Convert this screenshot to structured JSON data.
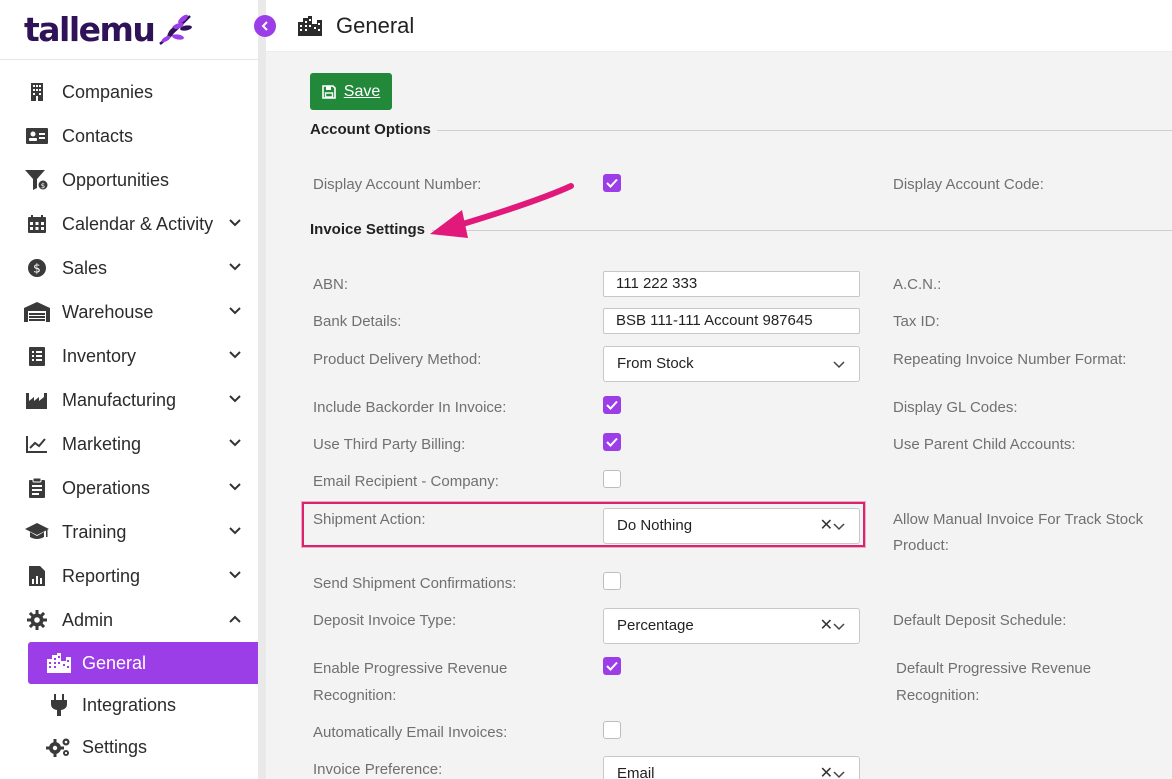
{
  "brand": {
    "logo_text": "tallemu",
    "accent": "#9b3ee8",
    "save_green": "#23893a",
    "annotation_pink": "#d9236f"
  },
  "sidebar": {
    "items": [
      {
        "label": "Companies",
        "icon": "building-icon",
        "expandable": false
      },
      {
        "label": "Contacts",
        "icon": "contact-card-icon",
        "expandable": false
      },
      {
        "label": "Opportunities",
        "icon": "funnel-dollar-icon",
        "expandable": false
      },
      {
        "label": "Calendar & Activity",
        "icon": "calendar-icon",
        "expandable": true
      },
      {
        "label": "Sales",
        "icon": "dollar-coin-icon",
        "expandable": true
      },
      {
        "label": "Warehouse",
        "icon": "warehouse-icon",
        "expandable": true
      },
      {
        "label": "Inventory",
        "icon": "clipboard-list-icon",
        "expandable": true
      },
      {
        "label": "Manufacturing",
        "icon": "factory-icon",
        "expandable": true
      },
      {
        "label": "Marketing",
        "icon": "trend-chart-icon",
        "expandable": true
      },
      {
        "label": "Operations",
        "icon": "clipboard-check-icon",
        "expandable": true
      },
      {
        "label": "Training",
        "icon": "graduation-cap-icon",
        "expandable": true
      },
      {
        "label": "Reporting",
        "icon": "report-chart-icon",
        "expandable": true
      },
      {
        "label": "Admin",
        "icon": "gear-icon",
        "expandable": true,
        "expanded": true
      }
    ],
    "admin_sub": [
      {
        "label": "General",
        "icon": "city-icon",
        "active": true
      },
      {
        "label": "Integrations",
        "icon": "plug-icon",
        "active": false
      },
      {
        "label": "Settings",
        "icon": "gears-icon",
        "active": false
      }
    ]
  },
  "header": {
    "title": "General",
    "icon": "city-icon"
  },
  "toolbar": {
    "save_label": "Save",
    "save_icon": "floppy-disk-icon"
  },
  "sections": {
    "account_options": "Account Options",
    "invoice_settings": "Invoice Settings"
  },
  "form": {
    "display_account_number": {
      "label": "Display Account Number:",
      "checked": true
    },
    "display_account_code": {
      "label": "Display Account Code:"
    },
    "abn": {
      "label": "ABN:",
      "value": "111 222 333"
    },
    "acn": {
      "label": "A.C.N.:"
    },
    "bank_details": {
      "label": "Bank Details:",
      "value": "BSB 111-111 Account 987645"
    },
    "tax_id": {
      "label": "Tax ID:"
    },
    "product_delivery_method": {
      "label": "Product Delivery Method:",
      "value": "From Stock"
    },
    "repeating_invoice_number_format": {
      "label": "Repeating Invoice Number Format:"
    },
    "include_backorder": {
      "label": "Include Backorder In Invoice:",
      "checked": true
    },
    "display_gl_codes": {
      "label": "Display GL Codes:"
    },
    "use_third_party_billing": {
      "label": "Use Third Party Billing:",
      "checked": true
    },
    "use_parent_child_accounts": {
      "label": "Use Parent Child Accounts:"
    },
    "email_recipient_company": {
      "label": "Email Recipient - Company:",
      "checked": false
    },
    "shipment_action": {
      "label": "Shipment Action:",
      "value": "Do Nothing"
    },
    "allow_manual_invoice_line1": "Allow Manual Invoice For Track Stock",
    "allow_manual_invoice_line2": "Product:",
    "send_shipment_confirmations": {
      "label": "Send Shipment Confirmations:",
      "checked": false
    },
    "deposit_invoice_type": {
      "label": "Deposit Invoice Type:",
      "value": "Percentage"
    },
    "default_deposit_schedule": {
      "label": "Default Deposit Schedule:"
    },
    "enable_progressive_line1": "Enable Progressive Revenue",
    "enable_progressive_line2": "Recognition:",
    "enable_progressive_checked": true,
    "default_progressive_line1": "Default Progressive Revenue",
    "default_progressive_line2": "Recognition:",
    "automatically_email_invoices": {
      "label": "Automatically Email Invoices:",
      "checked": false
    },
    "invoice_preference": {
      "label": "Invoice Preference:",
      "value": "Email"
    }
  },
  "clear_glyph": "✕"
}
